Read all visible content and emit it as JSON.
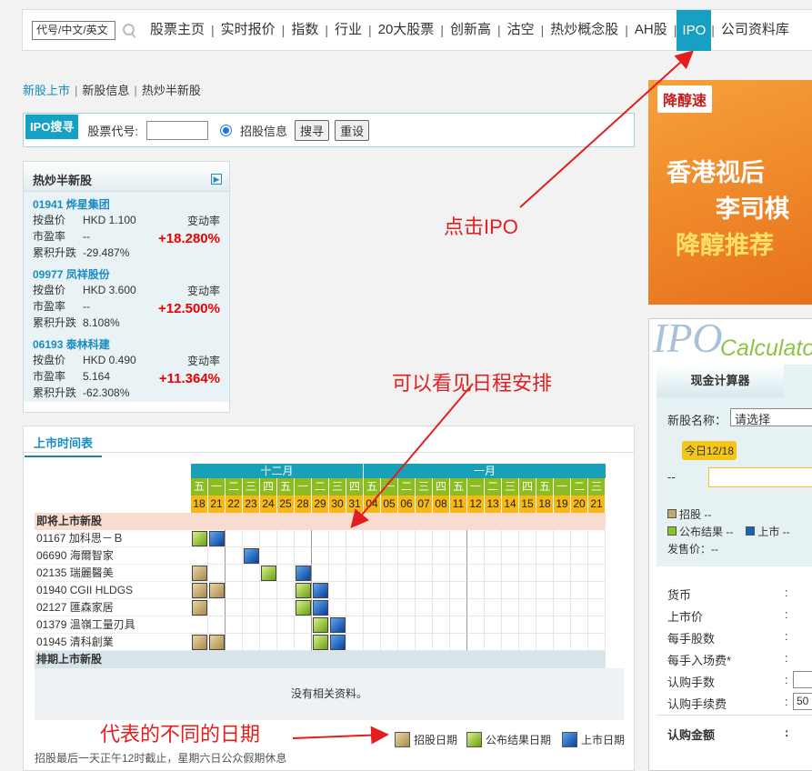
{
  "topnav": {
    "search_value": "代号/中文/英文",
    "items": [
      "股票主页",
      "实时报价",
      "指数",
      "行业",
      "20大股票",
      "创新高",
      "沽空",
      "热炒概念股",
      "AH股",
      "IPO",
      "公司资料库"
    ],
    "active_index": 9
  },
  "subnav": {
    "items": [
      "新股上市",
      "新股信息",
      "热炒半新股"
    ],
    "active_index": 0
  },
  "ipo_search": {
    "tag": "IPO搜寻",
    "code_label": "股票代号:",
    "radio_label": "招股信息",
    "search_button": "搜寻",
    "reset_button": "重设"
  },
  "hot_stocks": {
    "title": "热炒半新股",
    "labels": {
      "price": "按盘价",
      "pe": "市盈率",
      "cum": "累积升跌",
      "change": "变动率"
    },
    "items": [
      {
        "name": "01941 烨星集团",
        "price": "HKD 1.100",
        "pe": "--",
        "cum": "-29.487%",
        "pct": "+18.280%"
      },
      {
        "name": "09977 凤祥股份",
        "price": "HKD 3.600",
        "pe": "--",
        "cum": "8.108%",
        "pct": "+12.500%"
      },
      {
        "name": "06193 泰林科建",
        "price": "HKD 0.490",
        "pe": "5.164",
        "cum": "-62.308%",
        "pct": "+11.364%"
      }
    ]
  },
  "schedule": {
    "tab": "上市时间表",
    "months": [
      "十二月",
      "一月"
    ],
    "weekdays": [
      "五",
      "一",
      "二",
      "三",
      "四",
      "五",
      "一",
      "二",
      "三",
      "四",
      "五",
      "一",
      "二",
      "三",
      "四",
      "五",
      "一",
      "二",
      "三",
      "四",
      "五",
      "一",
      "二",
      "三"
    ],
    "dates": [
      "18",
      "21",
      "22",
      "23",
      "24",
      "25",
      "28",
      "29",
      "30",
      "31",
      "04",
      "05",
      "06",
      "07",
      "08",
      "11",
      "12",
      "13",
      "14",
      "15",
      "18",
      "19",
      "20",
      "21"
    ],
    "section_upcoming": "即将上市新股",
    "section_planned": "排期上市新股",
    "no_data": "没有相关资料。",
    "rows": [
      {
        "name": "01167 加科思－Ｂ",
        "marks": [
          [
            0,
            "g"
          ],
          [
            1,
            "b"
          ]
        ]
      },
      {
        "name": "06690 海爾智家",
        "marks": [
          [
            3,
            "b"
          ]
        ]
      },
      {
        "name": "02135 瑞麗醫美",
        "marks": [
          [
            0,
            "t"
          ],
          [
            4,
            "g"
          ],
          [
            6,
            "b"
          ]
        ]
      },
      {
        "name": "01940 CGII HLDGS",
        "marks": [
          [
            0,
            "t"
          ],
          [
            1,
            "t"
          ],
          [
            6,
            "g"
          ],
          [
            7,
            "b"
          ]
        ]
      },
      {
        "name": "02127 匯森家居",
        "marks": [
          [
            0,
            "t"
          ],
          [
            6,
            "g"
          ],
          [
            7,
            "b"
          ]
        ]
      },
      {
        "name": "01379 溫嶺工量刃具",
        "marks": [
          [
            7,
            "g"
          ],
          [
            8,
            "b"
          ]
        ]
      },
      {
        "name": "01945 清科創業",
        "marks": [
          [
            0,
            "t"
          ],
          [
            1,
            "t"
          ],
          [
            7,
            "g"
          ],
          [
            8,
            "b"
          ]
        ]
      }
    ],
    "legend": [
      "招股日期",
      "公布结果日期",
      "上市日期"
    ],
    "footnote": "招股最后一天正午12时截止，星期六日公众假期休息"
  },
  "ad": {
    "logo": "降醇速",
    "line1": "香港视后",
    "line2": "李司棋",
    "line3": "降醇推荐"
  },
  "calculator": {
    "logo": "IPO",
    "logo2": "Calculator",
    "tab": "现金计算器",
    "stock_label": "新股名称：",
    "select_value": "请选择",
    "today": "今日12/18",
    "dash": "--",
    "legend_t": "招股 --",
    "legend_g": "公布结果 --",
    "legend_b": "上市 --",
    "issue_price": "发售价：--",
    "fields": [
      "货币",
      "上市价",
      "每手股数",
      "每手入场费*",
      "认购手数",
      "认购手续费"
    ],
    "fee_value": "50",
    "total_label": "认购金额"
  },
  "annotations": {
    "click_ipo": "点击IPO",
    "see_schedule": "可以看见日程安排",
    "diff_dates": "代表的不同的日期"
  },
  "colors": {
    "accent": "#17a0c3",
    "teal_header": "#17a0b8",
    "yellow_header": "#8cbd1f",
    "date_row": "#f5b818",
    "annotation": "#e31e1e",
    "tan": "#c2a96b",
    "green": "#8cc420",
    "blue": "#1565c0"
  }
}
